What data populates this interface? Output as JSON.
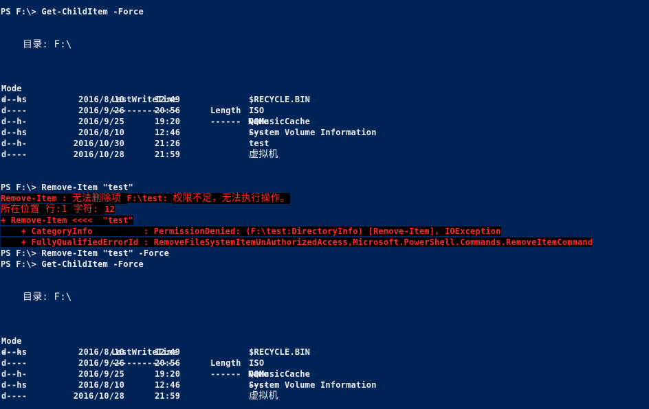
{
  "console": {
    "background": "#012456",
    "text_color": "#eeedf0",
    "error_color": "#ff2a2a"
  },
  "blocks": {
    "cmd1": "PS F:\\> Get-ChildItem -Force",
    "dir1": "目录: F:\\",
    "headers": {
      "mode": "Mode",
      "lwt": "LastWriteTime",
      "length": "Length",
      "name": "Name"
    },
    "underlines": {
      "mode": "----",
      "lwt": "-------------",
      "length": "------",
      "name": "----"
    },
    "listing1": [
      {
        "mode": "d--hs",
        "date": "2016/8/10",
        "time": "12:49",
        "name": "$RECYCLE.BIN"
      },
      {
        "mode": "d----",
        "date": "2016/9/26",
        "time": "20:56",
        "name": "ISO"
      },
      {
        "mode": "d--h-",
        "date": "2016/9/25",
        "time": "19:20",
        "name": "QQMusicCache"
      },
      {
        "mode": "d--hs",
        "date": "2016/8/10",
        "time": "12:46",
        "name": "System Volume Information"
      },
      {
        "mode": "d--h-",
        "date": "2016/10/30",
        "time": "21:26",
        "name": "test"
      },
      {
        "mode": "d----",
        "date": "2016/10/28",
        "time": "21:59",
        "name": "虚拟机"
      }
    ],
    "cmd2": "PS F:\\> Remove-Item \"test\"",
    "error": {
      "line1_a": "Remove-Item : ",
      "line1_b": "无法删除项 ",
      "line1_c": "F:\\test: ",
      "line1_d": "权限不足，无法执行操作。",
      "line2_a": "所在位置 行:1 字符: ",
      "line2_b": "12",
      "line3": "+ Remove-Item <<<<  \"test\"",
      "line4": "    + CategoryInfo          : PermissionDenied: (F:\\test:DirectoryInfo) [Remove-Item], IOException",
      "line5": "    + FullyQualifiedErrorId : RemoveFileSystemItemUnAuthorizedAccess,Microsoft.PowerShell.Commands.RemoveItemCommand"
    },
    "cmd3": "PS F:\\> Remove-Item \"test\" -Force",
    "cmd4": "PS F:\\> Get-ChildItem -Force",
    "dir2": "目录: F:\\",
    "listing2": [
      {
        "mode": "d--hs",
        "date": "2016/8/10",
        "time": "12:49",
        "name": "$RECYCLE.BIN"
      },
      {
        "mode": "d----",
        "date": "2016/9/26",
        "time": "20:56",
        "name": "ISO"
      },
      {
        "mode": "d--h-",
        "date": "2016/9/25",
        "time": "19:20",
        "name": "QQMusicCache"
      },
      {
        "mode": "d--hs",
        "date": "2016/8/10",
        "time": "12:46",
        "name": "System Volume Information"
      },
      {
        "mode": "d----",
        "date": "2016/10/28",
        "time": "21:59",
        "name": "虚拟机"
      }
    ]
  }
}
